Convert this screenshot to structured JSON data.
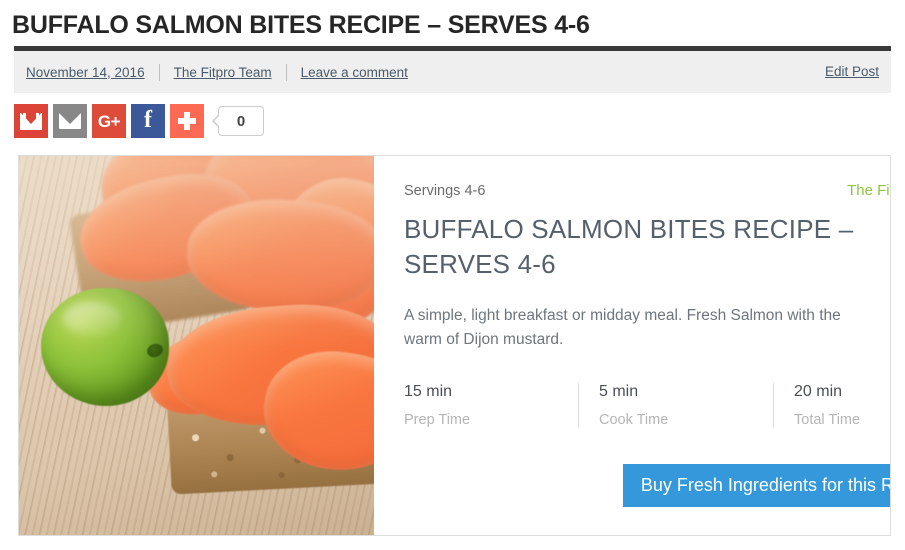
{
  "post": {
    "title": "BUFFALO SALMON BITES RECIPE – SERVES 4-6"
  },
  "meta": {
    "date": "November 14, 2016",
    "author": "The Fitpro Team",
    "comment_link": "Leave a comment",
    "edit_link": "Edit Post"
  },
  "share": {
    "buttons": [
      {
        "name": "gmail",
        "label": "Gmail",
        "color": "#db4437"
      },
      {
        "name": "email",
        "label": "Email",
        "color": "#888888"
      },
      {
        "name": "google-plus",
        "label": "G+",
        "color": "#dd4b39"
      },
      {
        "name": "facebook",
        "label": "f",
        "color": "#3b5998"
      },
      {
        "name": "more",
        "label": "+",
        "color": "#fc6a54"
      }
    ],
    "count": "0"
  },
  "recipe": {
    "servings": "Servings 4-6",
    "author": "The Fitpro Team",
    "title": "BUFFALO SALMON BITES RECIPE – SERVES 4-6",
    "description": "A simple, light breakfast or midday meal. Fresh Salmon with the warm of Dijon mustard.",
    "times": [
      {
        "value": "15 min",
        "label": "Prep Time"
      },
      {
        "value": "5 min",
        "label": "Cook Time"
      },
      {
        "value": "20 min",
        "label": "Total Time"
      }
    ],
    "cta": "Buy Fresh Ingredients for this Recipe",
    "photo_alt": "Smoked salmon on rye crackers with a green olive on a wooden board"
  },
  "colors": {
    "accent_green": "#8dc63f",
    "cta_blue": "#3498db",
    "meta_bg": "#efefef",
    "title_dark": "#262626"
  }
}
